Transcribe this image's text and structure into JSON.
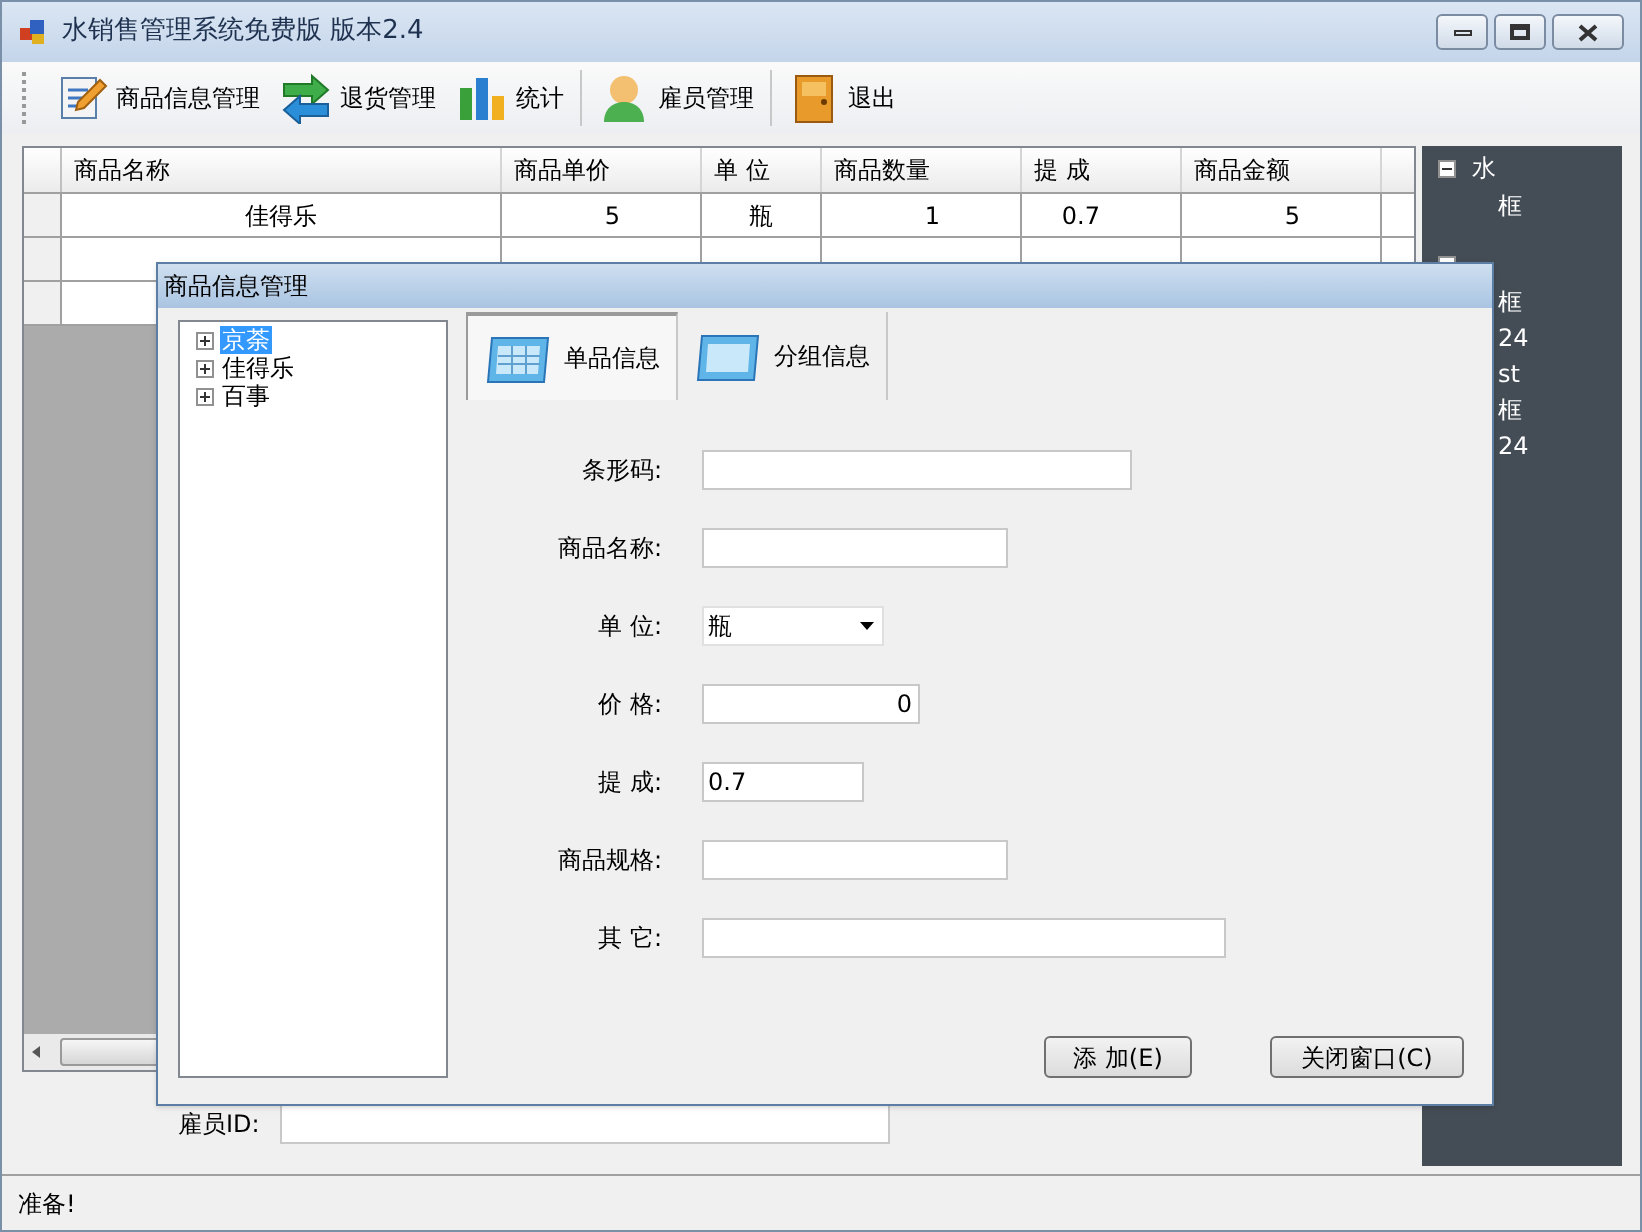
{
  "window": {
    "title": "水销售管理系统免费版 版本2.4"
  },
  "toolbar": [
    {
      "label": "商品信息管理"
    },
    {
      "label": "退货管理"
    },
    {
      "label": "统计"
    },
    {
      "label": "雇员管理"
    },
    {
      "label": "退出"
    }
  ],
  "table": {
    "columns": [
      "商品名称",
      "商品单价",
      "单 位",
      "商品数量",
      "提 成",
      "商品金额"
    ],
    "rows": [
      [
        "佳得乐",
        "5",
        "瓶",
        "1",
        "0.7",
        "5"
      ]
    ]
  },
  "side_tree": [
    {
      "label": "水",
      "expanded": true,
      "children": [
        {
          "label": "框"
        }
      ]
    },
    {
      "expanded": true,
      "children": [
        {
          "label": "框"
        },
        {
          "label": "24"
        },
        {
          "label": "st"
        },
        {
          "label": "框"
        },
        {
          "label": "24"
        }
      ]
    }
  ],
  "employee": {
    "label": "雇员ID:"
  },
  "status_bar": "准备!",
  "dialog": {
    "title": "商品信息管理",
    "tree": [
      {
        "label": "京荼",
        "expanded": false,
        "selected": true
      },
      {
        "label": "佳得乐",
        "expanded": false,
        "selected": false
      },
      {
        "label": "百事",
        "expanded": false,
        "selected": false
      }
    ],
    "tabs": [
      {
        "label": "单品信息",
        "selected": true
      },
      {
        "label": "分组信息",
        "selected": false
      }
    ],
    "fields": [
      {
        "label": "条形码:",
        "kind": "text"
      },
      {
        "label": "商品名称:",
        "kind": "text"
      },
      {
        "label": "单 位:",
        "kind": "dropdown",
        "value": "瓶"
      },
      {
        "label": "价 格:",
        "kind": "number",
        "value": "0"
      },
      {
        "label": "提 成:",
        "kind": "text",
        "value": "0.7"
      },
      {
        "label": "商品规格:",
        "kind": "text"
      },
      {
        "label": "其 它:",
        "kind": "text"
      }
    ],
    "buttons": [
      "添 加(E)",
      "关闭窗口(C)"
    ]
  }
}
